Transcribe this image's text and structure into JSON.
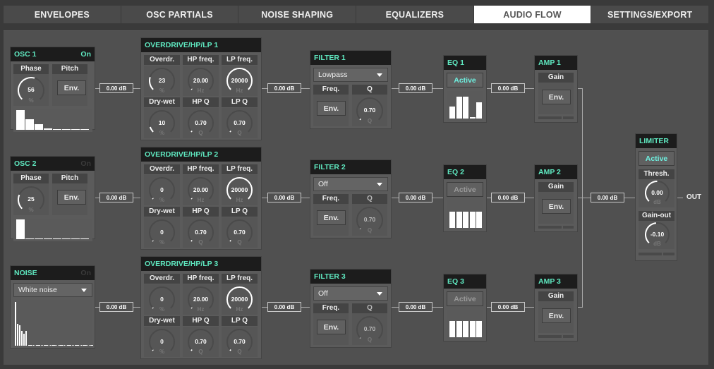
{
  "tabs": [
    {
      "label": "ENVELOPES",
      "active": false
    },
    {
      "label": "OSC PARTIALS",
      "active": false
    },
    {
      "label": "NOISE SHAPING",
      "active": false
    },
    {
      "label": "EQUALIZERS",
      "active": false
    },
    {
      "label": "AUDIO FLOW",
      "active": true
    },
    {
      "label": "SETTINGS/EXPORT",
      "active": false
    }
  ],
  "sources": [
    {
      "title": "OSC 1",
      "toggle": "On",
      "enabled": true,
      "phase_label": "Phase",
      "phase_value": "56",
      "phase_unit": "%",
      "pitch_label": "Pitch",
      "env_label": "Env.",
      "partials": [
        1.0,
        0.55,
        0.3,
        0.07,
        0.03,
        0.03,
        0.03,
        0.03
      ]
    },
    {
      "title": "OSC 2",
      "toggle": "On",
      "enabled": false,
      "phase_label": "Phase",
      "phase_value": "25",
      "phase_unit": "%",
      "pitch_label": "Pitch",
      "env_label": "Env.",
      "partials": [
        1.0,
        0.03,
        0.03,
        0.03,
        0.03,
        0.03,
        0.03,
        0.03
      ]
    }
  ],
  "noise": {
    "title": "NOISE",
    "toggle": "On",
    "enabled": false,
    "type": "White noise",
    "spectrum": [
      1.0,
      0.5,
      0.46,
      0.34,
      0.27,
      0.34
    ]
  },
  "overdrives": [
    {
      "title": "OVERDRIVE/HP/LP 1",
      "knobs": [
        {
          "label": "Overdr.",
          "value": "23",
          "unit": "%",
          "level": 0.23
        },
        {
          "label": "HP freq.",
          "value": "20.00",
          "unit": "Hz",
          "level": 0.0
        },
        {
          "label": "LP freq.",
          "value": "20000",
          "unit": "Hz",
          "level": 1.0
        },
        {
          "label": "Dry-wet",
          "value": "10",
          "unit": "%",
          "level": 0.1
        },
        {
          "label": "HP Q",
          "value": "0.70",
          "unit": "Q",
          "level": 0.02
        },
        {
          "label": "LP Q",
          "value": "0.70",
          "unit": "Q",
          "level": 0.02
        }
      ]
    },
    {
      "title": "OVERDRIVE/HP/LP 2",
      "knobs": [
        {
          "label": "Overdr.",
          "value": "0",
          "unit": "%",
          "level": 0.0
        },
        {
          "label": "HP freq.",
          "value": "20.00",
          "unit": "Hz",
          "level": 0.0
        },
        {
          "label": "LP freq.",
          "value": "20000",
          "unit": "Hz",
          "level": 1.0
        },
        {
          "label": "Dry-wet",
          "value": "0",
          "unit": "%",
          "level": 0.0
        },
        {
          "label": "HP Q",
          "value": "0.70",
          "unit": "Q",
          "level": 0.02
        },
        {
          "label": "LP Q",
          "value": "0.70",
          "unit": "Q",
          "level": 0.02
        }
      ]
    },
    {
      "title": "OVERDRIVE/HP/LP 3",
      "knobs": [
        {
          "label": "Overdr.",
          "value": "0",
          "unit": "%",
          "level": 0.0
        },
        {
          "label": "HP freq.",
          "value": "20.00",
          "unit": "Hz",
          "level": 0.0
        },
        {
          "label": "LP freq.",
          "value": "20000",
          "unit": "Hz",
          "level": 1.0
        },
        {
          "label": "Dry-wet",
          "value": "0",
          "unit": "%",
          "level": 0.0
        },
        {
          "label": "HP Q",
          "value": "0.70",
          "unit": "Q",
          "level": 0.02
        },
        {
          "label": "LP Q",
          "value": "0.70",
          "unit": "Q",
          "level": 0.02
        }
      ]
    }
  ],
  "filters": [
    {
      "title": "FILTER 1",
      "type": "Lowpass",
      "enabled": true,
      "freq_label": "Freq.",
      "env_label": "Env.",
      "q_label": "Q",
      "q_value": "0.70",
      "q_unit": "Q",
      "q_level": 0.02
    },
    {
      "title": "FILTER 2",
      "type": "Off",
      "enabled": false,
      "freq_label": "Freq.",
      "env_label": "Env.",
      "q_label": "Q",
      "q_value": "0.70",
      "q_unit": "Q",
      "q_level": 0.02
    },
    {
      "title": "FILTER 3",
      "type": "Off",
      "enabled": false,
      "freq_label": "Freq.",
      "env_label": "Env.",
      "q_label": "Q",
      "q_value": "0.70",
      "q_unit": "Q",
      "q_level": 0.02
    }
  ],
  "eqs": [
    {
      "title": "EQ 1",
      "button": "Active",
      "active": true,
      "bands": [
        0.55,
        1.0,
        1.0,
        0.05,
        0.75
      ]
    },
    {
      "title": "EQ 2",
      "button": "Active",
      "active": false,
      "bands": [
        0.75,
        0.75,
        0.75,
        0.75,
        0.75
      ]
    },
    {
      "title": "EQ 3",
      "button": "Active",
      "active": false,
      "bands": [
        0.75,
        0.75,
        0.75,
        0.75,
        0.75
      ]
    }
  ],
  "amps": [
    {
      "title": "AMP 1",
      "gain_label": "Gain",
      "env_label": "Env."
    },
    {
      "title": "AMP 2",
      "gain_label": "Gain",
      "env_label": "Env."
    },
    {
      "title": "AMP 3",
      "gain_label": "Gain",
      "env_label": "Env."
    }
  ],
  "limiter": {
    "title": "LIMITER",
    "button": "Active",
    "thresh_label": "Thresh.",
    "thresh_value": "0.00",
    "thresh_unit": "dB",
    "thresh_level": 0.5,
    "gain_label": "Gain-out",
    "gain_value": "-0.10",
    "gain_unit": "dB",
    "gain_level": 0.48
  },
  "gains": {
    "row1": [
      "0.00 dB",
      "0.00 dB",
      "0.00 dB",
      "0.00 dB"
    ],
    "row2": [
      "0.00 dB",
      "0.00 dB",
      "0.00 dB",
      "0.00 dB"
    ],
    "row3": [
      "0.00 dB",
      "0.00 dB",
      "0.00 dB",
      "0.00 dB"
    ],
    "master": "0.00 dB"
  },
  "output_label": "OUT",
  "colors": {
    "accent": "#5fe8c0",
    "active_button": "#6ef0e0",
    "selected_tab_bg": "#ffffff"
  }
}
